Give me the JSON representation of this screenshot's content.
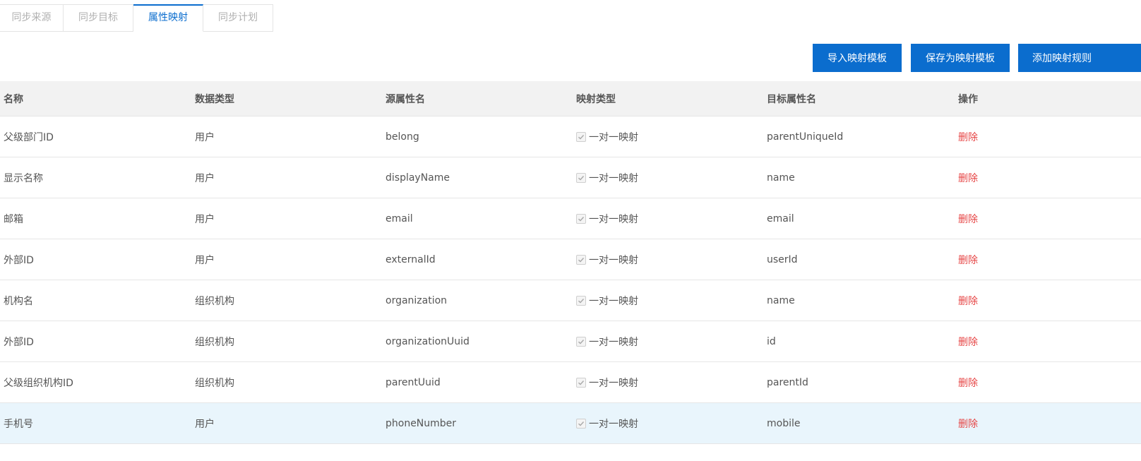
{
  "tabs": [
    {
      "label": "同步来源",
      "active": false
    },
    {
      "label": "同步目标",
      "active": false
    },
    {
      "label": "属性映射",
      "active": true
    },
    {
      "label": "同步计划",
      "active": false
    }
  ],
  "toolbar": {
    "import_label": "导入映射模板",
    "save_label": "保存为映射模板",
    "add_label": "添加映射规则"
  },
  "table": {
    "headers": [
      "名称",
      "数据类型",
      "源属性名",
      "映射类型",
      "目标属性名",
      "操作"
    ],
    "rows": [
      {
        "name": "父级部门ID",
        "type": "用户",
        "source": "belong",
        "mapping": "一对一映射",
        "target": "parentUniqueId",
        "action": "删除"
      },
      {
        "name": "显示名称",
        "type": "用户",
        "source": "displayName",
        "mapping": "一对一映射",
        "target": "name",
        "action": "删除"
      },
      {
        "name": "邮箱",
        "type": "用户",
        "source": "email",
        "mapping": "一对一映射",
        "target": "email",
        "action": "删除"
      },
      {
        "name": "外部ID",
        "type": "用户",
        "source": "externalId",
        "mapping": "一对一映射",
        "target": "userId",
        "action": "删除"
      },
      {
        "name": "机构名",
        "type": "组织机构",
        "source": "organization",
        "mapping": "一对一映射",
        "target": "name",
        "action": "删除"
      },
      {
        "name": "外部ID",
        "type": "组织机构",
        "source": "organizationUuid",
        "mapping": "一对一映射",
        "target": "id",
        "action": "删除"
      },
      {
        "name": "父级组织机构ID",
        "type": "组织机构",
        "source": "parentUuid",
        "mapping": "一对一映射",
        "target": "parentId",
        "action": "删除"
      },
      {
        "name": "手机号",
        "type": "用户",
        "source": "phoneNumber",
        "mapping": "一对一映射",
        "target": "mobile",
        "action": "删除"
      }
    ]
  },
  "colors": {
    "accent": "#0b6dce",
    "danger": "#e64545",
    "highlight_row": "#e9f5fc"
  }
}
